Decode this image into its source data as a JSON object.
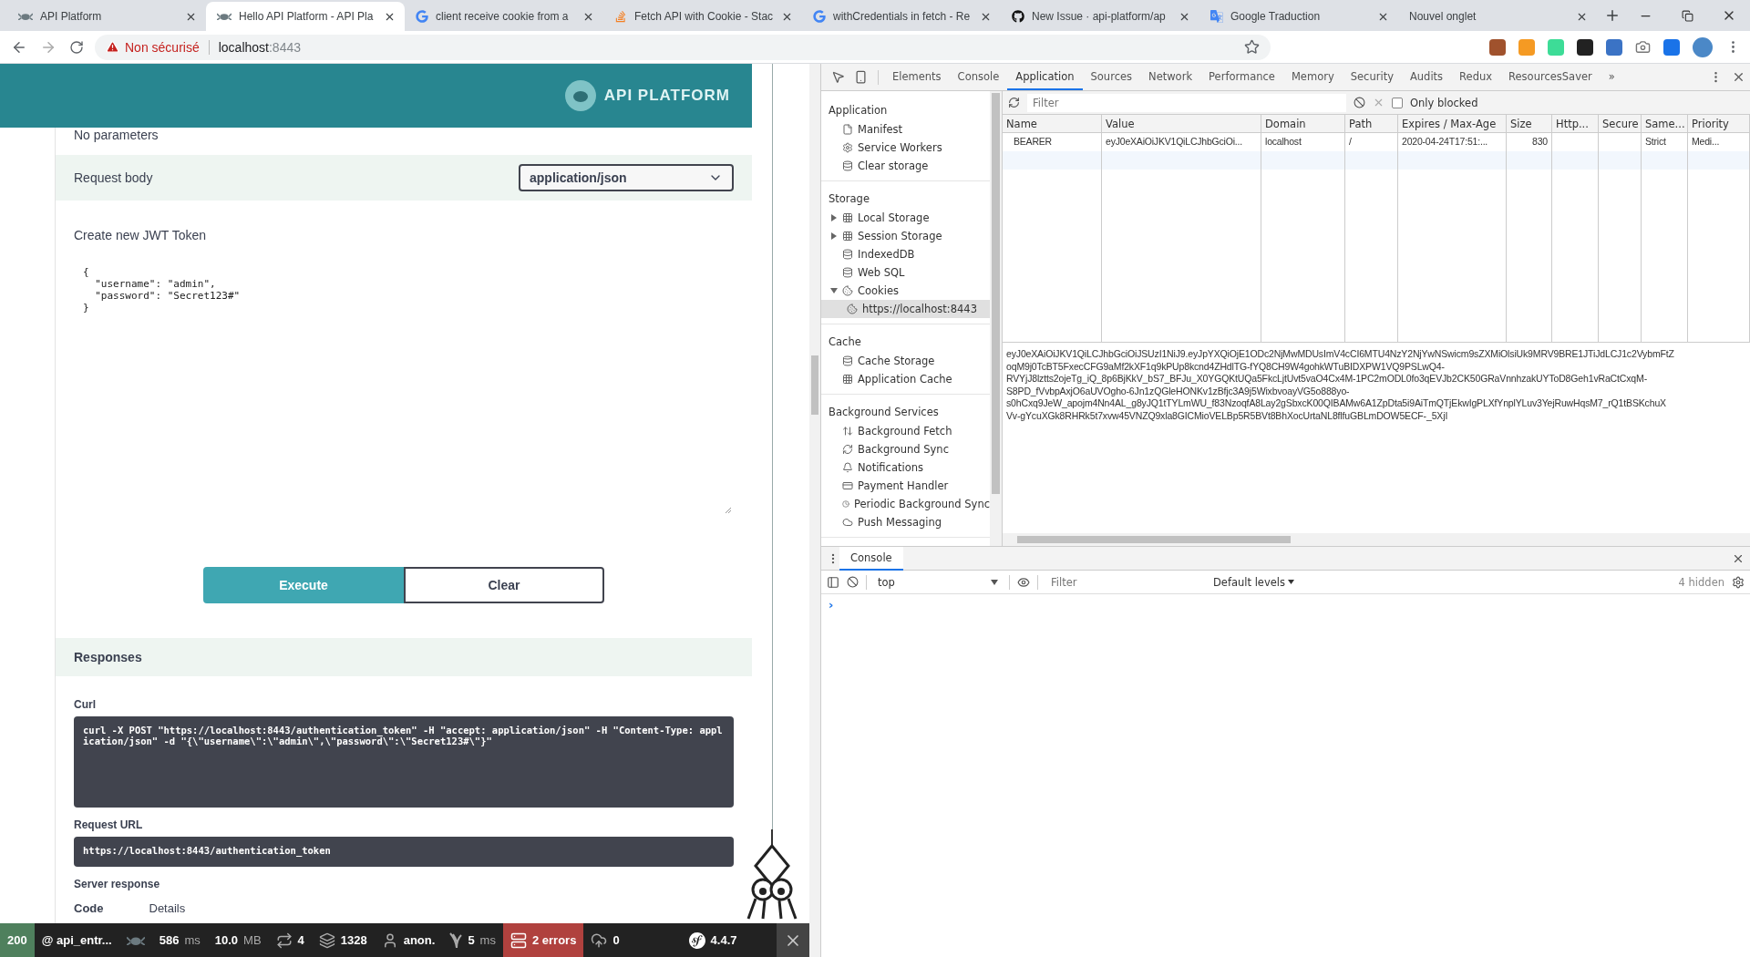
{
  "browser": {
    "tabs": [
      {
        "title": "API Platform",
        "kind": "spider",
        "selected": false
      },
      {
        "title": "Hello API Platform - API Pla",
        "kind": "spider",
        "selected": true
      },
      {
        "title": "client receive cookie from a",
        "kind": "google",
        "selected": false
      },
      {
        "title": "Fetch API with Cookie - Stac",
        "kind": "stack",
        "selected": false
      },
      {
        "title": "withCredentials in fetch - Re",
        "kind": "google",
        "selected": false
      },
      {
        "title": "New Issue · api-platform/ap",
        "kind": "github",
        "selected": false
      },
      {
        "title": "Google Traduction",
        "kind": "translate",
        "selected": false
      },
      {
        "title": "Nouvel onglet",
        "kind": "none",
        "selected": false
      }
    ],
    "address": {
      "warning": "Non sécurisé",
      "host": "localhost",
      "port": ":8443"
    }
  },
  "page": {
    "logo": "API PLATFORM",
    "parameters_note": "No parameters",
    "request_body": {
      "label": "Request body",
      "content_type": "application/json"
    },
    "description": "Create new JWT Token",
    "body": "{\n  \"username\": \"admin\",\n  \"password\": \"Secret123#\"\n}",
    "buttons": [
      {
        "label": "Execute",
        "kind": "primary"
      },
      {
        "label": "Clear",
        "kind": "secondary"
      }
    ],
    "responses": {
      "heading": "Responses",
      "curl_label": "Curl",
      "curl": "curl -X POST \"https://localhost:8443/authentication_token\" -H \"accept: application/json\" -H \"Content-Type: application/json\" -d \"{\\\"username\\\":\\\"admin\\\",\\\"password\\\":\\\"Secret123#\\\"}\"",
      "url_label": "Request URL",
      "url": "https://localhost:8443/authentication_token",
      "server_label": "Server response",
      "columns": [
        "Code",
        "Details"
      ]
    }
  },
  "symfony_bar": [
    {
      "kind": "status",
      "text": "200"
    },
    {
      "kind": "route",
      "text": "@ api_entr..."
    },
    {
      "kind": "ghost"
    },
    {
      "kind": "time",
      "text": "586",
      "unit": "ms"
    },
    {
      "kind": "memory",
      "text": "10.0",
      "unit": "MB"
    },
    {
      "kind": "loop",
      "text": "4"
    },
    {
      "kind": "layers",
      "text": "1328"
    },
    {
      "kind": "user",
      "text": "anon."
    },
    {
      "kind": "twig",
      "text": "5",
      "unit": "ms"
    },
    {
      "kind": "errors",
      "text": "2 errors"
    },
    {
      "kind": "cloud",
      "text": "0"
    },
    {
      "kind": "version",
      "text": "4.4.7"
    }
  ],
  "devtools": {
    "tabs": [
      {
        "label": "Elements",
        "selected": false
      },
      {
        "label": "Console",
        "selected": false
      },
      {
        "label": "Application",
        "selected": true
      },
      {
        "label": "Sources",
        "selected": false
      },
      {
        "label": "Network",
        "selected": false
      },
      {
        "label": "Performance",
        "selected": false
      },
      {
        "label": "Memory",
        "selected": false
      },
      {
        "label": "Security",
        "selected": false
      },
      {
        "label": "Audits",
        "selected": false
      },
      {
        "label": "Redux",
        "selected": false
      },
      {
        "label": "ResourcesSaver",
        "selected": false
      }
    ],
    "more_tabs": "»",
    "sidebar": [
      {
        "title": "Application",
        "items": [
          {
            "label": "Manifest",
            "kind": "file",
            "selected": false
          },
          {
            "label": "Service Workers",
            "kind": "gear",
            "selected": false
          },
          {
            "label": "Clear storage",
            "kind": "db",
            "selected": false
          }
        ]
      },
      {
        "title": "Storage",
        "items": [
          {
            "label": "Local Storage",
            "kind": "grid",
            "selected": false,
            "expanded": false
          },
          {
            "label": "Session Storage",
            "kind": "grid",
            "selected": false,
            "expanded": false
          },
          {
            "label": "IndexedDB",
            "kind": "db",
            "selected": false
          },
          {
            "label": "Web SQL",
            "kind": "db",
            "selected": false
          },
          {
            "label": "Cookies",
            "kind": "cookie",
            "selected": false,
            "expanded": true,
            "children": [
              {
                "label": "https://localhost:8443",
                "kind": "cookie",
                "selected": true
              }
            ]
          }
        ]
      },
      {
        "title": "Cache",
        "items": [
          {
            "label": "Cache Storage",
            "kind": "db",
            "selected": false
          },
          {
            "label": "Application Cache",
            "kind": "grid",
            "selected": false
          }
        ]
      },
      {
        "title": "Background Services",
        "items": [
          {
            "label": "Background Fetch",
            "kind": "updown",
            "selected": false
          },
          {
            "label": "Background Sync",
            "kind": "sync",
            "selected": false
          },
          {
            "label": "Notifications",
            "kind": "bell",
            "selected": false
          },
          {
            "label": "Payment Handler",
            "kind": "card",
            "selected": false
          },
          {
            "label": "Periodic Background Sync",
            "kind": "clock",
            "selected": false
          },
          {
            "label": "Push Messaging",
            "kind": "cloud",
            "selected": false
          }
        ]
      }
    ],
    "filter_placeholder": "Filter",
    "only_blocked": {
      "label": "Only blocked",
      "checked": false
    },
    "columns": [
      "Name",
      "Value",
      "Domain",
      "Path",
      "Expires / Max-Age",
      "Size",
      "Http...",
      "Secure",
      "Same...",
      "Priority"
    ],
    "rows": [
      [
        "BEARER",
        "eyJ0eXAiOiJKV1QiLCJhbGciOi...",
        "localhost",
        "/",
        "2020-04-24T17:51:...",
        "830",
        "",
        "",
        "Strict",
        "Medi..."
      ]
    ],
    "value_preview": [
      "eyJ0eXAiOiJKV1QiLCJhbGciOiJSUzI1NiJ9.eyJpYXQiOjE1ODc2NjMwMDUsImV4cCI6MTU4NzY2NjYwNSwicm9sZXMiOlsiUk9MRV9BRE1JTiJdLCJ1c2VybmFtZ",
      "oqM9j0TcBT5FxecCFG9aMf2kXF1q9kPUp8kcnd4ZHdlTG-fYQ8CH9W4gohkWTuBIDXPW1VQ9PSLwQ4-",
      "RVYjJ8lztts2ojeTg_iQ_8p6BjKkV_bS7_BFJu_X0YGQKtUQa5FkcLjtUvt5vaO4Cx4M-1PC2mODL0fo3qEVJb2CK50GRaVnnhzakUYToD8Geh1vRaCtCxqM-",
      "S8PD_fVvbpAxjO6aUVOgho-6Jn1zQGleHONKv1zBfjc3A9j5WixbvoayVG5o888yo-",
      "s0hCxq9JeW_apojm4Nn4AL_g8yJQ1tTYLmWU_f83NzoqfA8Lay2gSbxcK00QIBAMw6A1ZpDta5i9AiTmQTjEkwIgPLXfYnplYLuv3YejRuwHqsM7_rQ1tBSKchuX",
      "Vv-gYcuXGk8RHRk5t7xvw45VNZQ9xla8GICMioVELBp5R5BVt8BhXocUrtaNL8flfuGBLmDOW5ECF-_5XjI"
    ],
    "drawer": {
      "tabs": [
        {
          "label": "Console",
          "selected": true
        }
      ],
      "context": "top",
      "filter_placeholder": "Filter",
      "levels": "Default levels",
      "hidden": "4 hidden",
      "prompt": "›"
    }
  }
}
